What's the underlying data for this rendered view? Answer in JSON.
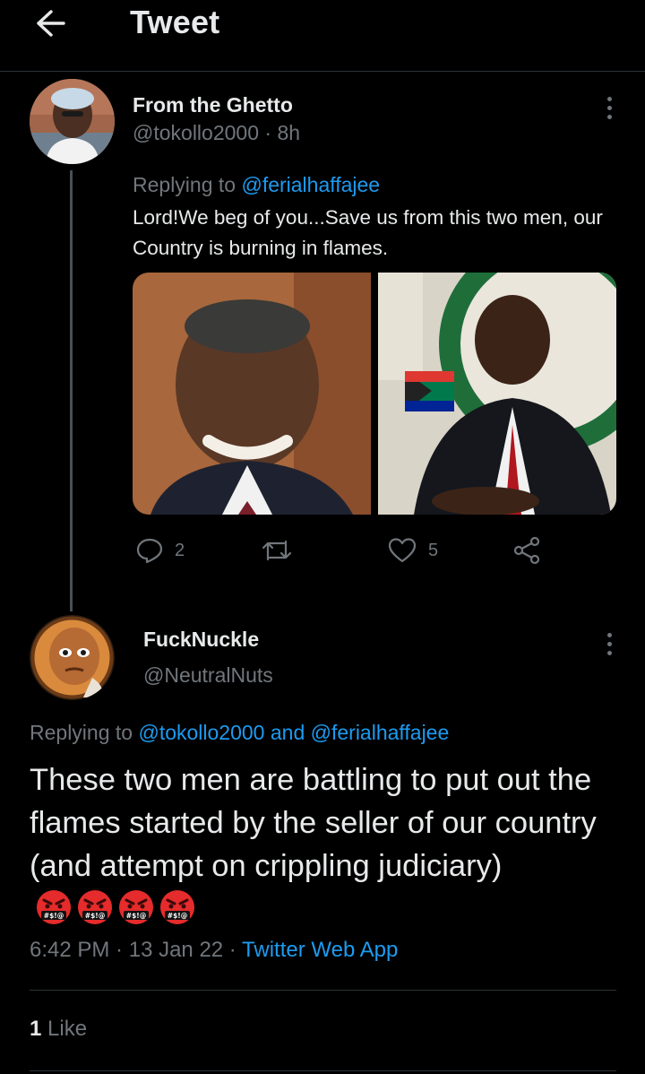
{
  "header": {
    "title": "Tweet",
    "back_icon": "arrow-left-icon"
  },
  "parent_tweet": {
    "author_name": "From the Ghetto",
    "handle": "@tokollo2000",
    "time": "8h",
    "replying_prefix": "Replying to ",
    "replying_to": "@ferialhaffajee",
    "text": "Lord!We beg of you...Save us from this two men, our Country is burning in flames.",
    "actions": {
      "reply_count": "2",
      "retweet_count": "",
      "like_count": "5"
    }
  },
  "main_tweet": {
    "author_name": "FuckNuckle",
    "handle": "@NeutralNuts",
    "replying_prefix": "Replying to ",
    "replying_to_1": "@tokollo2000",
    "replying_and": " and ",
    "replying_to_2": "@ferialhaffajee",
    "text": "These two men are battling to put out the flames started by the seller of our country (and attempt on crippling judiciary)",
    "emojis": [
      "face-with-symbols-on-mouth",
      "face-with-symbols-on-mouth",
      "face-with-symbols-on-mouth",
      "face-with-symbols-on-mouth"
    ],
    "time": "6:42 PM",
    "date": "13 Jan 22",
    "source": "Twitter Web App",
    "like_count": "1",
    "like_label": "Like"
  },
  "colors": {
    "background": "#000000",
    "text": "#e7e9ea",
    "muted": "#71767b",
    "link": "#1d9bf0",
    "divider": "#2f3336"
  }
}
